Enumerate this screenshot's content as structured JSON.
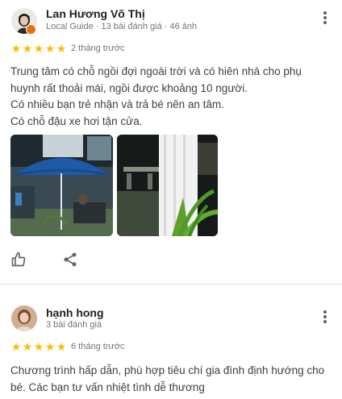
{
  "reviews": [
    {
      "name": "Lan Hương Võ Thị",
      "meta": "Local Guide · 13 bài đánh giá · 46 ảnh",
      "rating": 5,
      "stars": "★★★★★",
      "time": "2 tháng trước",
      "lines": [
        "Trung tâm có chỗ ngồi đợi ngoài trời và có hiên nhà cho phụ",
        "huynh rất thoải mái, ngồi được khoảng 10 người.",
        "Có nhiều bạn trẻ nhận và trả bé nên an tâm.",
        "Có chỗ đậu xe hơi tận cửa."
      ]
    },
    {
      "name": "hạnh hong",
      "meta": "3 bài đánh giá",
      "rating": 5,
      "stars": "★★★★★",
      "time": "6 tháng trước",
      "lines": [
        "Chương trình hấp dẫn, phù hợp tiêu chí gia đình định hướng cho",
        "bé. Các bạn tư vấn nhiệt tình dễ thương"
      ]
    }
  ],
  "colors": {
    "star": "#fbbc04",
    "guide_badge": "#e8710a",
    "icon": "#5f6368"
  },
  "icons": {
    "more": "more-vert-icon",
    "like": "thumb-up-icon",
    "share": "share-icon"
  }
}
